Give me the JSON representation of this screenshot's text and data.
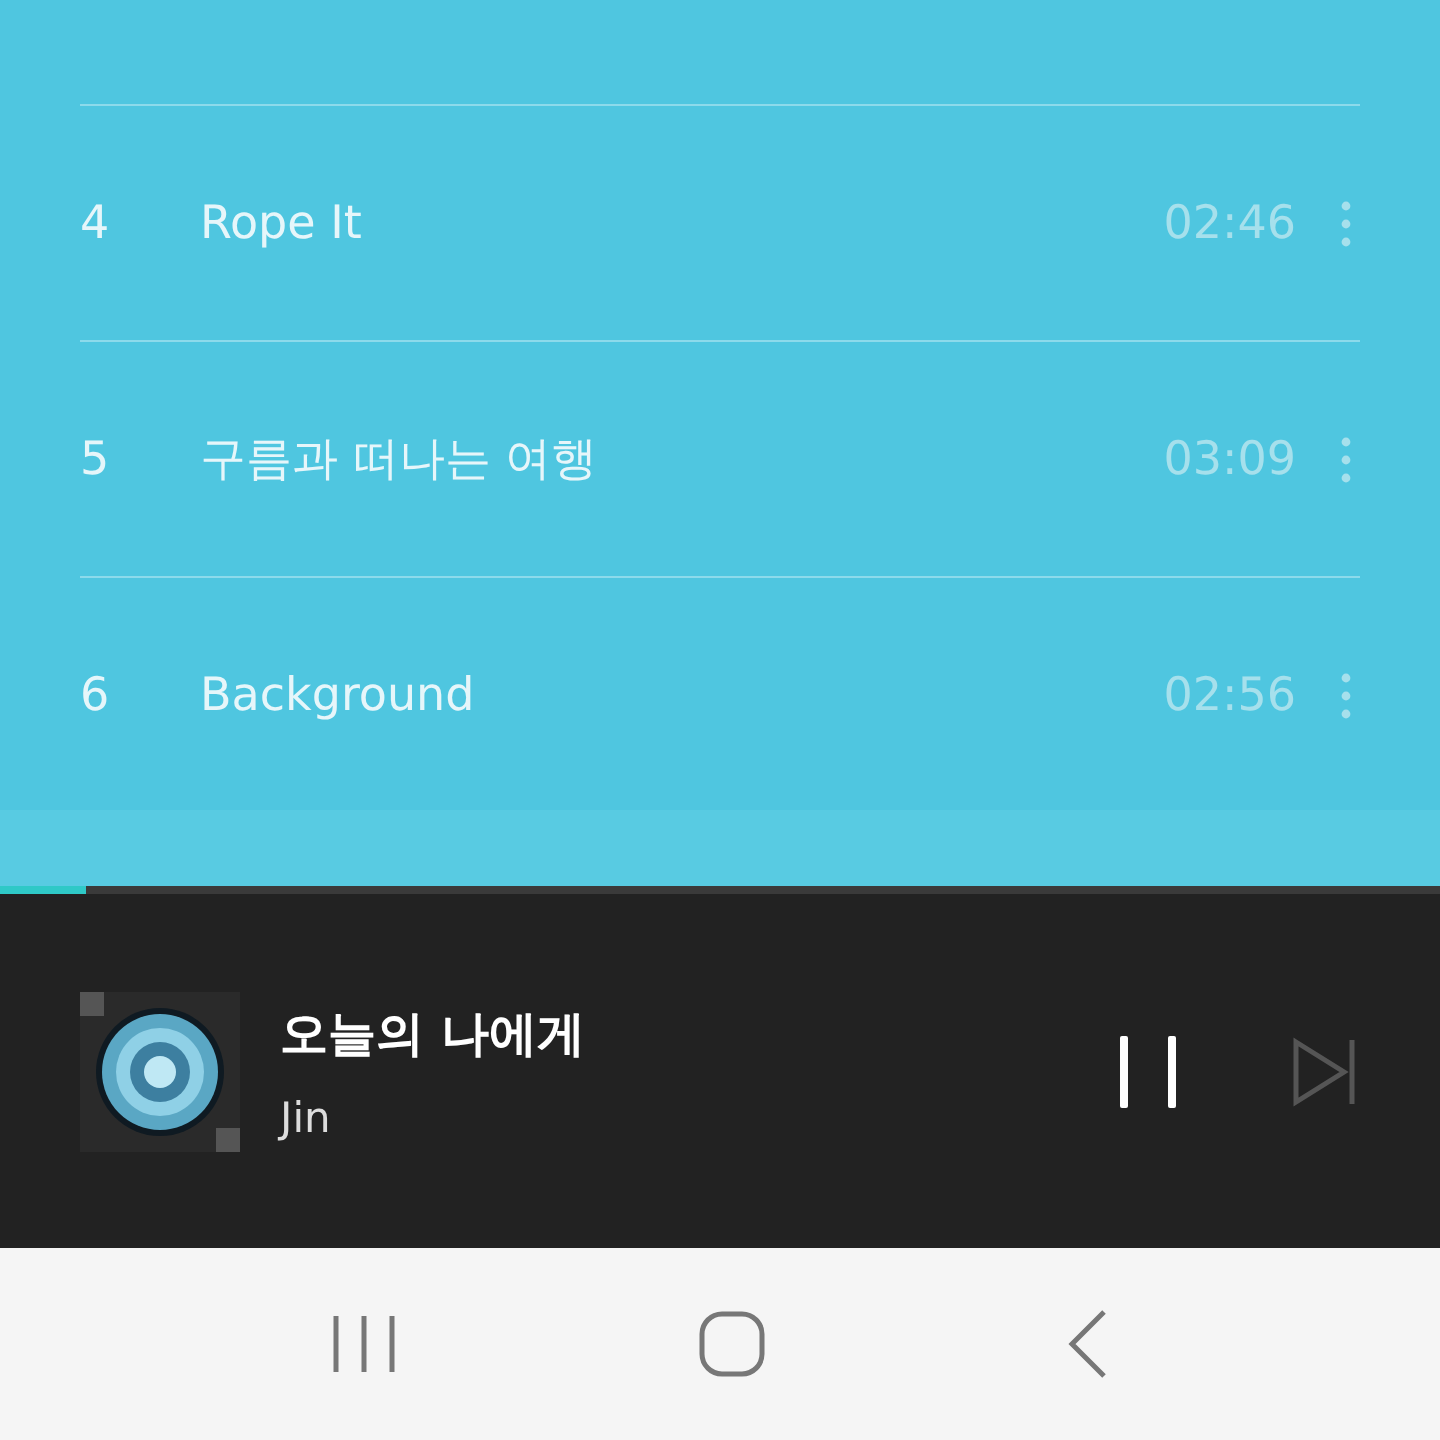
{
  "tracks": [
    {
      "number": "4",
      "title": "Rope It",
      "duration": "02:46"
    },
    {
      "number": "5",
      "title": "구름과 떠나는 여행",
      "duration": "03:09"
    },
    {
      "number": "6",
      "title": "Background",
      "duration": "02:56"
    }
  ],
  "player": {
    "title": "오늘의 나에게",
    "artist": "Jin",
    "level": 0.06,
    "playing": true
  },
  "nav_bar": {
    "buttons": [
      {
        "kind": "recents"
      },
      {
        "kind": "home"
      },
      {
        "kind": "back"
      }
    ]
  }
}
